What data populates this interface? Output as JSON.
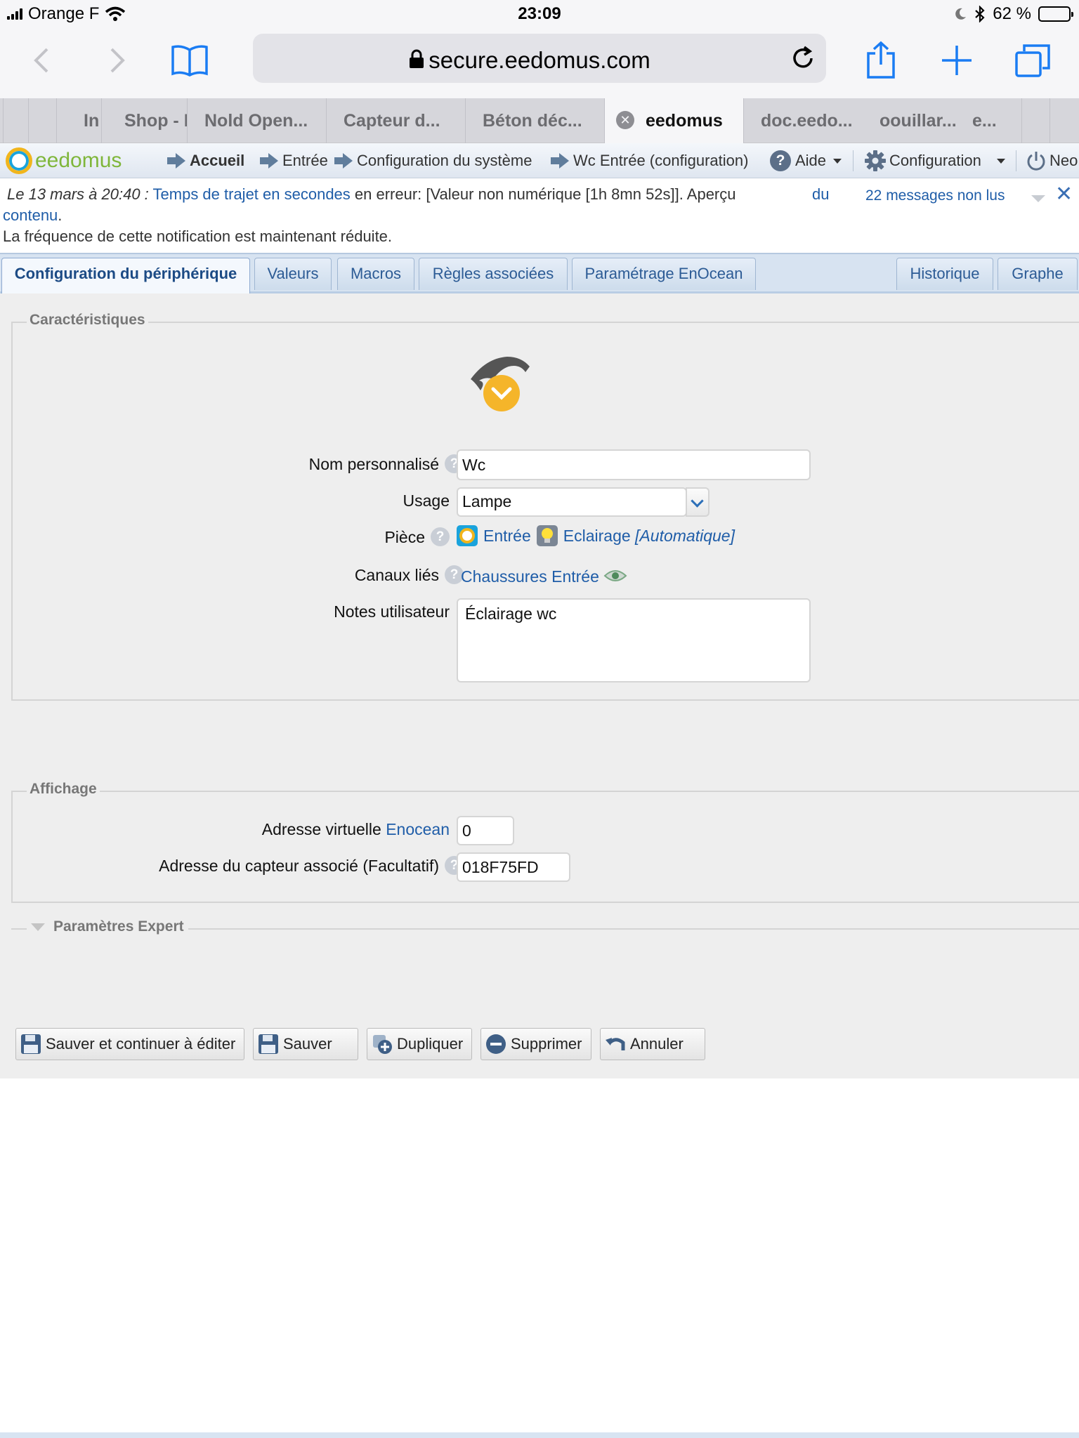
{
  "status_bar": {
    "carrier": "Orange F",
    "time": "23:09",
    "battery": "62 %",
    "battery_level": 0.62
  },
  "browser": {
    "url": "secure.eedomus.com",
    "tabs": [
      {
        "label": "In",
        "active": false
      },
      {
        "label": "Shop - I",
        "active": false
      },
      {
        "label": "Nold Open...",
        "active": false
      },
      {
        "label": "Capteur d...",
        "active": false
      },
      {
        "label": "Béton déc...",
        "active": false
      },
      {
        "label": "eedomus",
        "active": true
      },
      {
        "label": "doc.eedo...",
        "active": false
      },
      {
        "label": "oouillar...",
        "active": false
      },
      {
        "label": "e...",
        "active": false
      }
    ]
  },
  "menu": {
    "logo": "eedomus",
    "breadcrumb": [
      "Accueil",
      "Entrée",
      "Configuration du système",
      "Wc Entrée (configuration)"
    ],
    "help": "Aide",
    "config": "Configuration",
    "user": "Neo"
  },
  "notification": {
    "date": "Le 13 mars à 20:40 :",
    "link": "Temps de trajet en secondes",
    "message": " en erreur: [Valeur non numérique [1h 8mn 52s]]. Aperçu ",
    "link2a": "du",
    "link2b": "contenu",
    "period": ".",
    "line2": "La fréquence de cette notification est maintenant réduite.",
    "unread": "22 messages non lus"
  },
  "tabs": {
    "items": [
      {
        "label": "Configuration du périphérique",
        "active": true
      },
      {
        "label": "Valeurs"
      },
      {
        "label": "Macros"
      },
      {
        "label": "Règles associées"
      },
      {
        "label": "Paramétrage EnOcean"
      },
      {
        "label": "Historique"
      },
      {
        "label": "Graphe"
      }
    ]
  },
  "characteristics": {
    "legend": "Caractéristiques",
    "name_label": "Nom personnalisé",
    "name_value": "Wc",
    "usage_label": "Usage",
    "usage_value": "Lampe",
    "room_label": "Pièce",
    "room_value": "Entrée",
    "category_value": "Eclairage",
    "category_mode": "[Automatique]",
    "channels_label": "Canaux liés",
    "channels_value": "Chaussures Entrée",
    "notes_label": "Notes utilisateur",
    "notes_value": "Éclairage wc"
  },
  "display": {
    "legend": "Affichage",
    "virtual_label": "Adresse virtuelle",
    "virtual_link": "Enocean",
    "virtual_value": "0",
    "sensor_label": "Adresse du capteur associé (Facultatif)",
    "sensor_value": "018F75FD"
  },
  "expert": {
    "legend": "Paramètres Expert"
  },
  "buttons": {
    "save_continue": "Sauver et continuer à éditer",
    "save": "Sauver",
    "duplicate": "Dupliquer",
    "delete": "Supprimer",
    "cancel": "Annuler"
  },
  "colors": {
    "accent": "#1f5da8",
    "logo_green": "#7fb63a",
    "badge_orange": "#f5b52a"
  }
}
